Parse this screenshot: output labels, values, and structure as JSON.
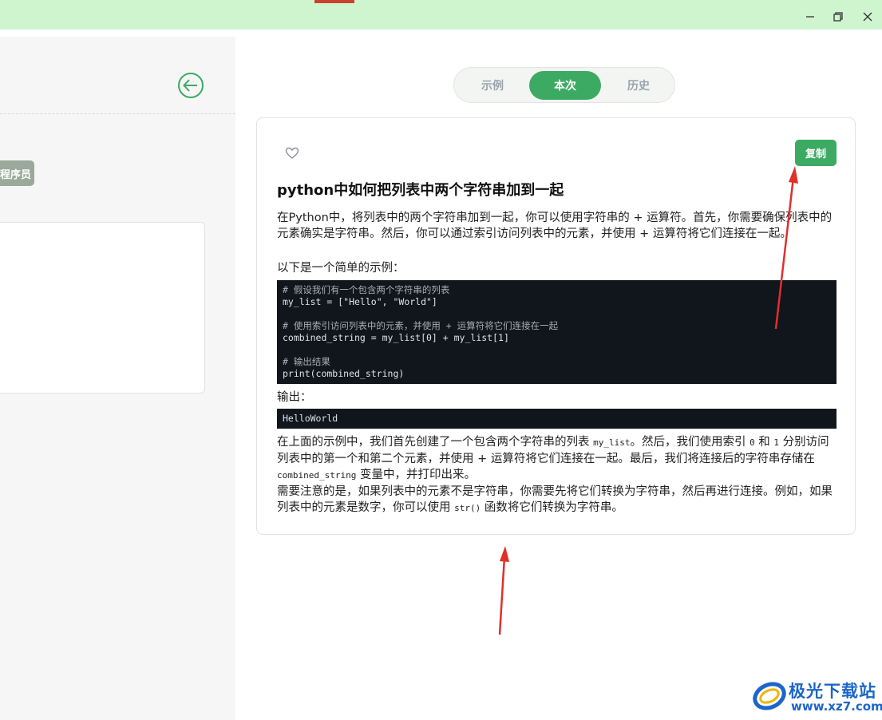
{
  "left_panel": {
    "role_chip": "程序员"
  },
  "tabs": [
    {
      "label": "示例"
    },
    {
      "label": "本次"
    },
    {
      "label": "历史"
    }
  ],
  "answer": {
    "copy_label": "复制",
    "title": "python中如何把列表中两个字符串加到一起",
    "intro": "在Python中，将列表中的两个字符串加到一起，你可以使用字符串的 + 运算符。首先，你需要确保列表中的元素确实是字符串。然后，你可以通过索引访问列表中的元素，并使用 + 运算符将它们连接在一起。",
    "example_lead": "以下是一个简单的示例：",
    "code_lines": [
      "# 假设我们有一个包含两个字符串的列表",
      "my_list = [\"Hello\", \"World\"]",
      "",
      "# 使用索引访问列表中的元素，并使用 + 运算符将它们连接在一起",
      "combined_string = my_list[0] + my_list[1]",
      "",
      "# 输出结果",
      "print(combined_string)"
    ],
    "output_label": "输出：",
    "output_code": "HelloWorld",
    "explain_1a": "在上面的示例中，我们首先创建了一个包含两个字符串的列表 ",
    "explain_code_1": "my_list",
    "explain_1b": "。然后，我们使用索引 ",
    "explain_code_2": "0",
    "explain_1c": " 和 ",
    "explain_code_3": "1",
    "explain_1d": " 分别访问列表中的第一个和第二个元素，并使用 + 运算符将它们连接在一起。最后，我们将连接后的字符串存储在 ",
    "explain_code_4": "combined_string",
    "explain_1e": " 变量中，并打印出来。",
    "explain_2a": "需要注意的是，如果列表中的元素不是字符串，你需要先将它们转换为字符串，然后再进行连接。例如，如果列表中的元素是数字，你可以使用 ",
    "explain_code_5": "str()",
    "explain_2b": " 函数将它们转换为字符串。"
  },
  "watermark": {
    "name": "极光下载站",
    "url": "www.xz7.com"
  },
  "colors": {
    "accent": "#3daa63",
    "titlebar": "#cff5cf",
    "code_bg": "#11151c",
    "arrow": "#e0302a"
  }
}
